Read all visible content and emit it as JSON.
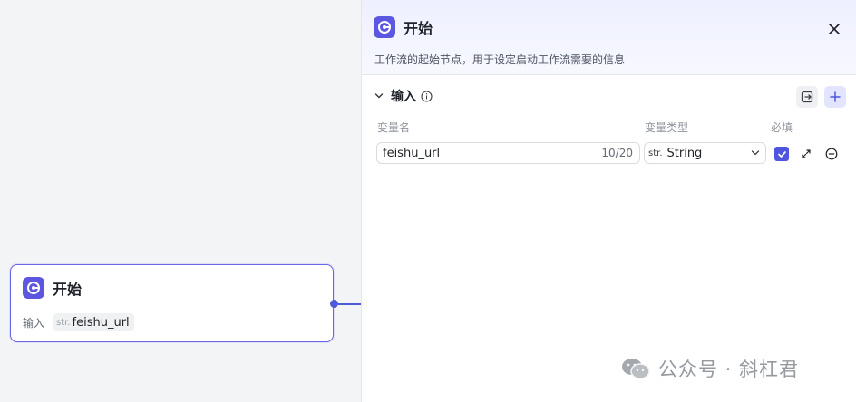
{
  "canvas": {
    "node": {
      "title": "开始",
      "row_label": "输入",
      "var_type": "str.",
      "var_name": "feishu_url"
    }
  },
  "panel": {
    "title": "开始",
    "description": "工作流的起始节点，用于设定启动工作流需要的信息",
    "section_title": "输入",
    "columns": {
      "name": "变量名",
      "type": "变量类型",
      "required": "必填"
    },
    "variable": {
      "name": "feishu_url",
      "count": "10/20",
      "type_mark": "str.",
      "type": "String",
      "required": true
    }
  },
  "watermark": {
    "text": "公众号 · 斜杠君"
  },
  "colors": {
    "accent": "#5b57e0",
    "node_border": "#6a66e8",
    "edge": "#4e5bd9",
    "panel_header": "#eef0ff"
  },
  "icons": {
    "app": "start-node-icon",
    "close": "close-icon",
    "collapse": "chevron-down-icon",
    "info": "info-icon",
    "import": "import-icon",
    "add": "plus-icon",
    "select_arrow": "chevron-down-icon",
    "expand": "expand-icon",
    "remove": "minus-circle-icon",
    "wechat": "wechat-icon"
  }
}
